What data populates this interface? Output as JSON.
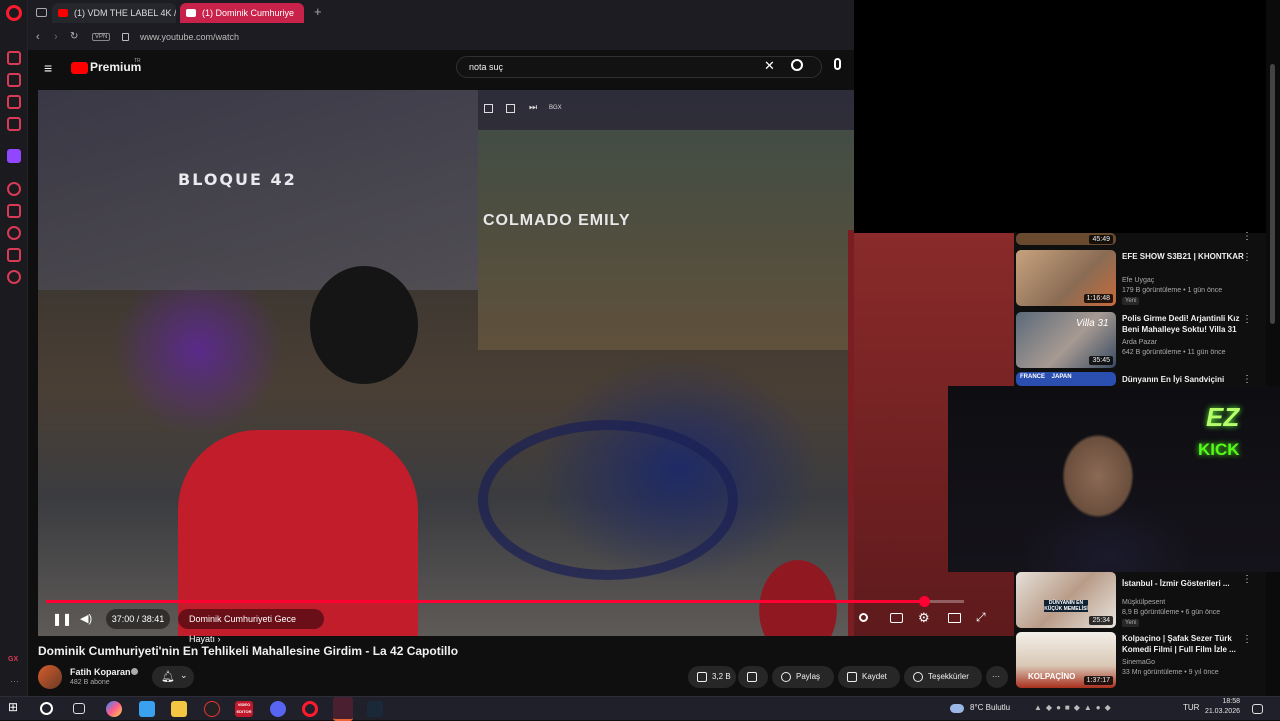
{
  "browser": {
    "tabs": [
      {
        "label": "(1) VDM THE LABEL 4K / 2"
      },
      {
        "label": "(1) Dominik Cumhuriye"
      }
    ],
    "vpn_label": "VPN",
    "url": "www.youtube.com/watch"
  },
  "youtube": {
    "logo_label": "Premium",
    "logo_region": "TR",
    "search_value": "nota suç"
  },
  "video": {
    "overlay_labels": [
      "BGX"
    ],
    "scene_signs": [
      "BLOQUE 42",
      "COLMADO EMILY"
    ],
    "current_time": "37:00 / 38:41",
    "chapter": "Dominik Cumhuriyeti Gece Hayatı",
    "progress_fraction": 0.956
  },
  "details": {
    "title": "Dominik Cumhuriyeti'nin En Tehlikeli Mahallesine Girdim - La 42 Capotillo",
    "channel": "Fatih Koparan",
    "subscribers": "482 B abone",
    "likes": "3,2 B",
    "share": "Paylaş",
    "save": "Kaydet",
    "thanks": "Teşekkürler"
  },
  "recommendations": [
    {
      "title": "",
      "duration": "45:49",
      "channel": "",
      "meta": "",
      "badge": ""
    },
    {
      "title": "EFE SHOW S3B21 | KHONTKAR",
      "duration": "1:16:48",
      "channel": "Efe Uygaç",
      "meta": "179 B görüntüleme • 1 gün önce",
      "badge": "Yeni"
    },
    {
      "title": "Polis Girme Dedi! Arjantinli Kız Beni Mahalleye Soktu! Villa 31",
      "duration": "35:45",
      "channel": "Arda Pazar",
      "meta": "642 B görüntüleme • 11 gün önce",
      "badge": ""
    },
    {
      "title": "Dünyanın En İyi Sandviçini",
      "duration": "",
      "channel": "",
      "meta": "",
      "badge": ""
    },
    {
      "title": "İstanbul - İzmir Gösterileri ...",
      "duration": "25:34",
      "channel": "Müşkülpesent",
      "meta": "8,9 B görüntüleme • 6 gün önce",
      "badge": "Yeni"
    },
    {
      "title": "Kolpaçino | Şafak Sezer Türk Komedi Filmi | Full Film İzle ...",
      "duration": "1:37:17",
      "channel": "SinemaGo",
      "meta": "33 Mn görüntüleme • 9 yıl önce",
      "badge": ""
    }
  ],
  "thumb_texts": {
    "villa": "Villa 31",
    "flags": "FRANCE    JAPAN",
    "dunyanin": "DÜNYANIN EN KÜÇÜK MEMELİSİ",
    "kolpacino": "KOLPAÇİNO"
  },
  "webcam": {
    "logo": "EZ",
    "platform": "KICK"
  },
  "taskbar": {
    "weather": "8°C  Bulutlu",
    "language": "TUR",
    "time": "18:58",
    "date": "21.03.2026",
    "video_app_label": "VIDEO EDITOR"
  },
  "colors": {
    "accent": "#ff0033",
    "opera": "#ff1b2d",
    "tab_active": "#c8224b",
    "kick": "#53fc18"
  }
}
